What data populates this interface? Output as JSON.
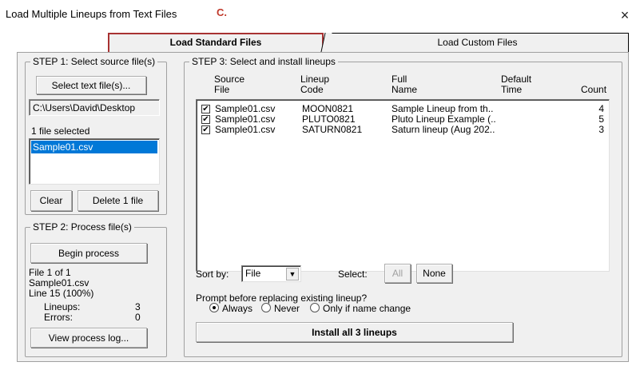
{
  "window": {
    "title": "Load Multiple Lineups from Text Files",
    "annotation": "C.",
    "close_glyph": "×"
  },
  "tabs": [
    {
      "label": "Load Standard Files",
      "active": true
    },
    {
      "label": "Load Custom Files",
      "active": false
    }
  ],
  "step1": {
    "legend": "STEP 1: Select source file(s)",
    "select_button": "Select text file(s)...",
    "path": "C:\\Users\\David\\Desktop",
    "selected_count": "1 file selected",
    "files": [
      "Sample01.csv"
    ],
    "clear_button": "Clear",
    "delete_button": "Delete 1 file"
  },
  "step2": {
    "legend": "STEP 2: Process file(s)",
    "begin_button": "Begin process",
    "status_line1": "File 1 of 1",
    "status_line2": "Sample01.csv",
    "status_line3": "Line 15 (100%)",
    "lineups_label": "Lineups:",
    "lineups_value": "3",
    "errors_label": "Errors:",
    "errors_value": "0",
    "log_button": "View process log..."
  },
  "step3": {
    "legend": "STEP 3: Select and install lineups",
    "columns": [
      {
        "line1": "Source",
        "line2": "File"
      },
      {
        "line1": "Lineup",
        "line2": "Code"
      },
      {
        "line1": "Full",
        "line2": "Name"
      },
      {
        "line1": "Default",
        "line2": "Time"
      },
      {
        "line1": "",
        "line2": "Count"
      }
    ],
    "rows": [
      {
        "checked": "✔",
        "file": "Sample01.csv",
        "code": "MOON0821",
        "name": "Sample Lineup from th..",
        "time": "",
        "count": "4"
      },
      {
        "checked": "✔",
        "file": "Sample01.csv",
        "code": "PLUTO0821",
        "name": "Pluto Lineup Example (..",
        "time": "",
        "count": "5"
      },
      {
        "checked": "✔",
        "file": "Sample01.csv",
        "code": "SATURN0821",
        "name": "Saturn lineup (Aug 202..",
        "time": "",
        "count": "3"
      }
    ],
    "sort_label": "Sort by:",
    "sort_value": "File",
    "select_label": "Select:",
    "all_button": "All",
    "none_button": "None",
    "prompt_label": "Prompt before replacing existing lineup?",
    "radio_always": "Always",
    "radio_never": "Never",
    "radio_only_if": "Only if name change",
    "radio_selected": "Always",
    "install_button": "Install all 3 lineups"
  }
}
